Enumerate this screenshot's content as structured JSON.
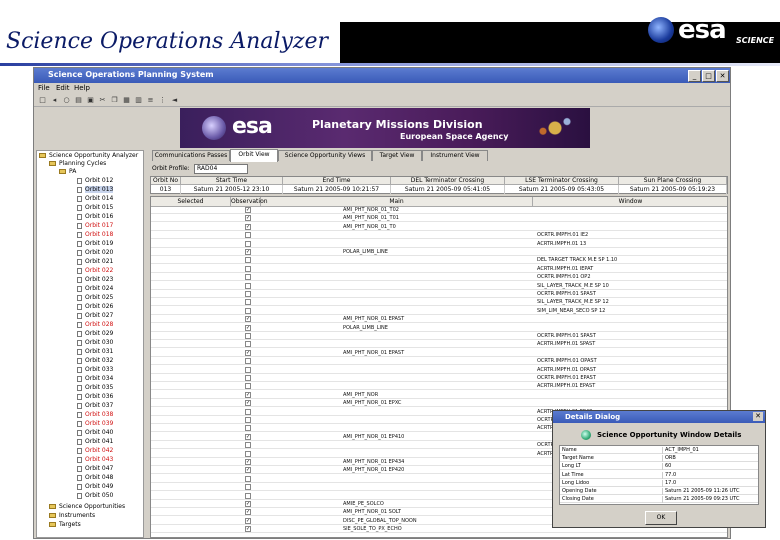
{
  "slide": {
    "title": "Science Operations Analyzer",
    "logo_text": "esa",
    "logo_sub": "SCIENCE"
  },
  "window": {
    "title": "Science Operations Planning System",
    "min": "_",
    "max": "□",
    "close": "✕"
  },
  "menu": [
    "File",
    "Edit",
    "Help"
  ],
  "banner": {
    "logo": "esa",
    "title": "Planetary Missions Division",
    "subtitle": "European Space Agency"
  },
  "tree": {
    "root": "Science Opportunity Analyzer",
    "planning": "Planning Cycles",
    "group": "PA",
    "items": [
      {
        "label": "Orbit 012",
        "red": false
      },
      {
        "label": "Orbit 013",
        "red": false,
        "selected": true
      },
      {
        "label": "Orbit 014",
        "red": false
      },
      {
        "label": "Orbit 015",
        "red": false
      },
      {
        "label": "Orbit 016",
        "red": false
      },
      {
        "label": "Orbit 017",
        "red": true
      },
      {
        "label": "Orbit 018",
        "red": true
      },
      {
        "label": "Orbit 019",
        "red": false
      },
      {
        "label": "Orbit 020",
        "red": false
      },
      {
        "label": "Orbit 021",
        "red": false
      },
      {
        "label": "Orbit 022",
        "red": true
      },
      {
        "label": "Orbit 023",
        "red": false
      },
      {
        "label": "Orbit 024",
        "red": false
      },
      {
        "label": "Orbit 025",
        "red": false
      },
      {
        "label": "Orbit 026",
        "red": false
      },
      {
        "label": "Orbit 027",
        "red": false
      },
      {
        "label": "Orbit 028",
        "red": true
      },
      {
        "label": "Orbit 029",
        "red": false
      },
      {
        "label": "Orbit 030",
        "red": false
      },
      {
        "label": "Orbit 031",
        "red": false
      },
      {
        "label": "Orbit 032",
        "red": false
      },
      {
        "label": "Orbit 033",
        "red": false
      },
      {
        "label": "Orbit 034",
        "red": false
      },
      {
        "label": "Orbit 035",
        "red": false
      },
      {
        "label": "Orbit 036",
        "red": false
      },
      {
        "label": "Orbit 037",
        "red": false
      },
      {
        "label": "Orbit 038",
        "red": true
      },
      {
        "label": "Orbit 039",
        "red": true
      },
      {
        "label": "Orbit 040",
        "red": false
      },
      {
        "label": "Orbit 041",
        "red": false
      },
      {
        "label": "Orbit 042",
        "red": true
      },
      {
        "label": "Orbit 043",
        "red": true
      },
      {
        "label": "Orbit 047",
        "red": false
      },
      {
        "label": "Orbit 048",
        "red": false
      },
      {
        "label": "Orbit 049",
        "red": false
      },
      {
        "label": "Orbit 050",
        "red": false
      }
    ],
    "science_opps": "Science Opportunities",
    "instruments": "Instruments",
    "targets": "Targets"
  },
  "tabs": [
    "Communications Passes",
    "Orbit View",
    "Science Opportunity Views",
    "Target View",
    "Instrument View"
  ],
  "profile": {
    "label": "Orbit Profile:",
    "value": "RAD04"
  },
  "timing": {
    "headers": [
      "Orbit No",
      "Start Time",
      "End Time",
      "DEL Terminator Crossing",
      "LSE Terminator Crossing",
      "Sun Plane Crossing"
    ],
    "row": [
      "013",
      "Saturn 21 2005-12 23:10",
      "Saturn 21 2005-09 10:21:57",
      "Saturn 21 2005-09 05:41:05",
      "Saturn 21 2005-09 05:43:05",
      "Saturn 21 2005-09 05:19:23"
    ]
  },
  "obs_headers": [
    "Selected",
    "Observation",
    "Main",
    "Window"
  ],
  "obs_rows": [
    {
      "checked": true,
      "main": "AMI_PHT_NOR_01_T02",
      "det": ""
    },
    {
      "checked": true,
      "main": "AMI_PHT_NOR_01_T01",
      "det": ""
    },
    {
      "checked": true,
      "main": "AMI_PHT_NOR_01_T0",
      "det": ""
    },
    {
      "checked": false,
      "main": "",
      "det": "OCRTR.IMPFH.01 IE2"
    },
    {
      "checked": false,
      "main": "",
      "det": "ACRTR.IMPFH.01 13"
    },
    {
      "checked": true,
      "main": "POLAR_LIMB_LINE",
      "det": ""
    },
    {
      "checked": false,
      "main": "",
      "det": "DEL TARGET TRACK M.E SP 1.10"
    },
    {
      "checked": false,
      "main": "",
      "det": "ACRTR.IMPFH.01 IEPAT"
    },
    {
      "checked": false,
      "main": "",
      "det": "OCRTR.IMPFH.01 OP2"
    },
    {
      "checked": false,
      "main": "",
      "det": "SIL_LAYER_TRACK_M.E SP 10"
    },
    {
      "checked": false,
      "main": "",
      "det": "OCRTR.IMPFH.01 SPAST"
    },
    {
      "checked": false,
      "main": "",
      "det": "SIL_LAYER_TRACK_M.E SP 12"
    },
    {
      "checked": false,
      "main": "",
      "det": "SIM_LIM_NEAR_SECO SP 12"
    },
    {
      "checked": true,
      "main": "AMI_PHT_NOR_01 EPAST",
      "det": ""
    },
    {
      "checked": true,
      "main": "POLAR_LIMB_LINE",
      "det": ""
    },
    {
      "checked": false,
      "main": "",
      "det": "OCRTR.IMPFH.01 SPAST"
    },
    {
      "checked": false,
      "main": "",
      "det": "ACRTR.IMPFH.01 SPAST"
    },
    {
      "checked": true,
      "main": "AMI_PHT_NOR_01 EPAST",
      "det": ""
    },
    {
      "checked": false,
      "main": "",
      "det": "OCRTR.IMPFH.01 OPAST"
    },
    {
      "checked": false,
      "main": "",
      "det": "ACRTR.IMPFH.01 OPAST"
    },
    {
      "checked": false,
      "main": "",
      "det": "OCRTR.IMPFH.01 EPAST"
    },
    {
      "checked": false,
      "main": "",
      "det": "ACRTR.IMPFH.01 EPAST"
    },
    {
      "checked": true,
      "main": "AMI_PHT_NOR",
      "det": ""
    },
    {
      "checked": true,
      "main": "AMI_PHT_NOR_01 EPXC",
      "det": ""
    },
    {
      "checked": false,
      "main": "",
      "det": "ACRTR.IMPFH.01 EP48"
    },
    {
      "checked": false,
      "main": "",
      "det": "OCRTR.IMPFH.01 EP48"
    },
    {
      "checked": false,
      "main": "",
      "det": "ACRTR.IMPFH.01 EP40"
    },
    {
      "checked": true,
      "main": "AMI_PHT_NOR_01 EP410",
      "det": ""
    },
    {
      "checked": false,
      "main": "",
      "det": "OCRTR.IMPFH.01 EP40"
    },
    {
      "checked": false,
      "main": "",
      "det": "ACRTR.IMPFH.01 EP40"
    },
    {
      "checked": true,
      "main": "AMI_PHT_NOR_01 EP434",
      "det": ""
    },
    {
      "checked": true,
      "main": "AMI_PHT_NOR_01 EP420",
      "det": ""
    },
    {
      "checked": false,
      "main": "",
      "det": ""
    },
    {
      "checked": false,
      "main": "",
      "det": ""
    },
    {
      "checked": false,
      "main": "",
      "det": ""
    },
    {
      "checked": true,
      "main": "AMIE_PE_SOLCO",
      "det": ""
    },
    {
      "checked": true,
      "main": "AMI_PHT_NOR_01 SOLT",
      "det": ""
    },
    {
      "checked": true,
      "main": "DISC_PE_GLOBAL_TOP_NOON",
      "det": ""
    },
    {
      "checked": true,
      "main": "SIE_SOLE_TO_PX_ECHO",
      "det": ""
    }
  ],
  "dialog": {
    "title": "Details Dialog",
    "heading": "Science Opportunity Window Details",
    "rows": [
      {
        "k": "Name",
        "v": "ACT_IMPH_01"
      },
      {
        "k": "Target Name",
        "v": "ORB"
      },
      {
        "k": "Long LT",
        "v": "60"
      },
      {
        "k": "Lat Time",
        "v": "77.0"
      },
      {
        "k": "Long Lidoo",
        "v": "17.0"
      },
      {
        "k": "Opening Date",
        "v": "Saturn 21 2005-09 11:26 UTC"
      },
      {
        "k": "Closing Date",
        "v": "Saturn 21 2005-09 09:23 UTC"
      }
    ],
    "ok": "OK"
  }
}
